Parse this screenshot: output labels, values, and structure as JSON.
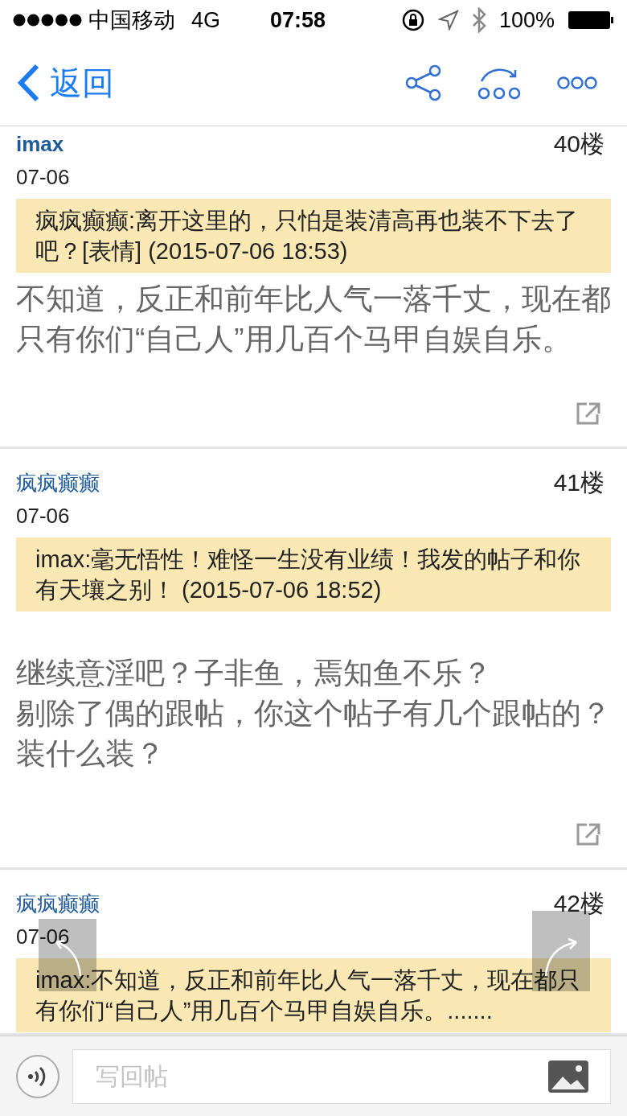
{
  "status_bar": {
    "carrier": "中国移动",
    "network": "4G",
    "time": "07:58",
    "battery": "100%"
  },
  "nav": {
    "back": "返回"
  },
  "posts": [
    {
      "author": "imax",
      "floor": "40楼",
      "date": "07-06",
      "quote": "疯疯癫癫:离开这里的，只怕是装清高再也装不下去了吧？[表情] (2015-07-06 18:53)",
      "body": [
        "不知道，反正和前年比人气一落千丈，现在都只有你们“自己人”用几百个马甲自娱自乐。"
      ]
    },
    {
      "author": "疯疯癫癫",
      "floor": "41楼",
      "date": "07-06",
      "quote": "imax:毫无悟性！难怪一生没有业绩！我发的帖子和你有天壤之别！ (2015-07-06 18:52)",
      "body": [
        "继续意淫吧？子非鱼，焉知鱼不乐？",
        "剔除了偶的跟帖，你这个帖子有几个跟帖的？装什么装？"
      ]
    },
    {
      "author": "疯疯癫癫",
      "floor": "42楼",
      "date": "07-06",
      "quote": "imax:不知道，反正和前年比人气一落千丈，现在都只有你们“自己人”用几百个马甲自娱自乐。......."
    }
  ],
  "reply_bar": {
    "placeholder": "写回帖"
  }
}
